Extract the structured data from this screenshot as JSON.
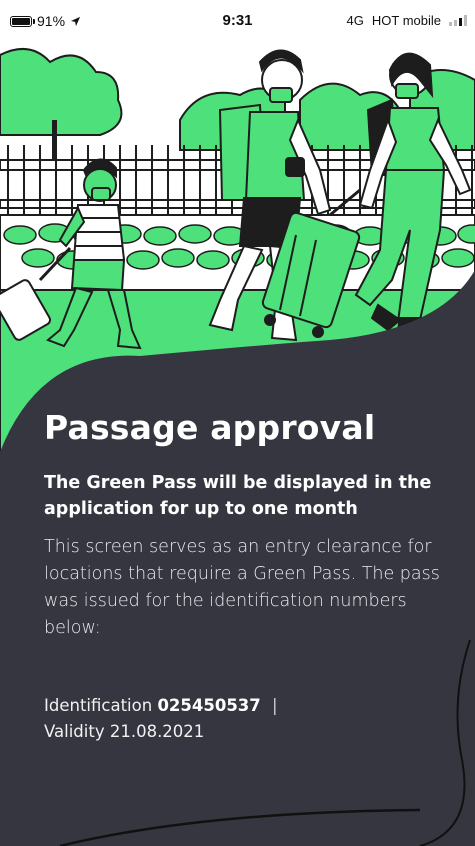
{
  "status_bar": {
    "battery": "91%",
    "time": "9:31",
    "network": "4G",
    "carrier": "HOT mobile"
  },
  "icons": [
    "battery-icon",
    "location-arrow-icon",
    "signal-icon"
  ],
  "colors": {
    "accent_green": "#4ee07b",
    "card_bg": "#363641",
    "text_white": "#ffffff"
  },
  "card": {
    "title": "Passage approval",
    "subtitle": "The Green Pass will be displayed in the application for up to one month",
    "description": "This screen serves as an entry clearance for locations that require a Green Pass. The pass was issued for the identification numbers below:",
    "identification_label": "Identification",
    "identification_number": "025450537",
    "separator": "|",
    "validity_label": "Validity",
    "validity_date": "21.08.2021"
  }
}
